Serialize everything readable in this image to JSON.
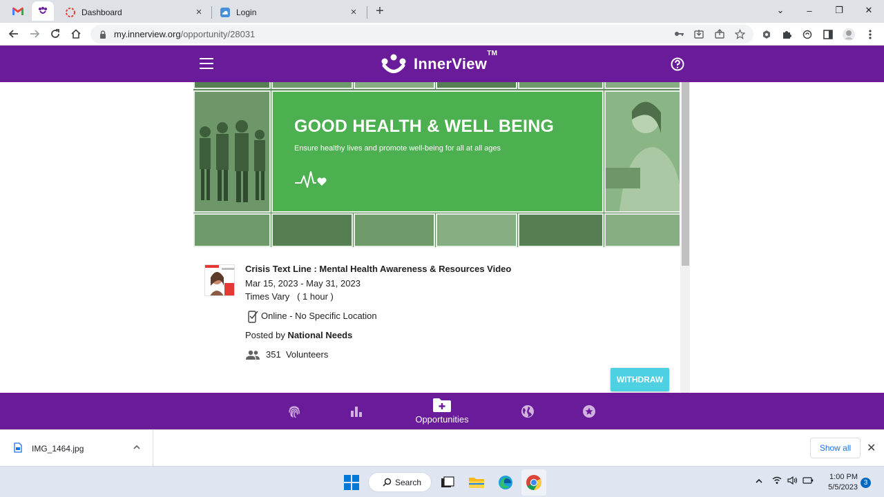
{
  "browser": {
    "tabs": [
      {
        "title": "Dashboard",
        "active": false
      },
      {
        "title": "Login",
        "active": true
      }
    ],
    "url_host": "my.innerview.org",
    "url_path": "/opportunity/28031",
    "new_tab_symbol": "+",
    "tab_close_symbol": "×",
    "window_controls": {
      "chevron": "⌄",
      "minimize": "–",
      "restore": "❐",
      "close": "✕"
    }
  },
  "app": {
    "brand": "InnerView",
    "trademark": "TM",
    "accent_color": "#6a1b9a"
  },
  "banner": {
    "headline": "GOOD HEALTH & WELL BEING",
    "subtitle": "Ensure healthy lives and promote well-being for all at all ages",
    "panel_color": "#4caf50"
  },
  "opportunity": {
    "title": "Crisis Text Line : Mental Health Awareness & Resources Video",
    "dates": "Mar 15, 2023 - May 31, 2023",
    "times": "Times Vary   ( 1 hour )",
    "location": "Online - No Specific Location",
    "posted_prefix": "Posted by ",
    "posted_org": "National Needs",
    "volunteer_count": "351",
    "volunteer_label": "Volunteers",
    "withdraw_label": "WITHDRAW",
    "withdraw_color": "#4dd0e1"
  },
  "bottom_nav": {
    "items": [
      {
        "icon": "fingerprint-icon"
      },
      {
        "icon": "bar-chart-icon"
      },
      {
        "icon": "folder-plus-icon",
        "label": "Opportunities",
        "active": true
      },
      {
        "icon": "globe-icon"
      },
      {
        "icon": "star-icon"
      }
    ]
  },
  "downloads": {
    "file_name": "IMG_1464.jpg",
    "show_all": "Show all",
    "close_symbol": "✕",
    "chevron": "^"
  },
  "taskbar": {
    "search_label": "Search",
    "time": "1:00 PM",
    "date": "5/5/2023",
    "notification_count": "3"
  }
}
